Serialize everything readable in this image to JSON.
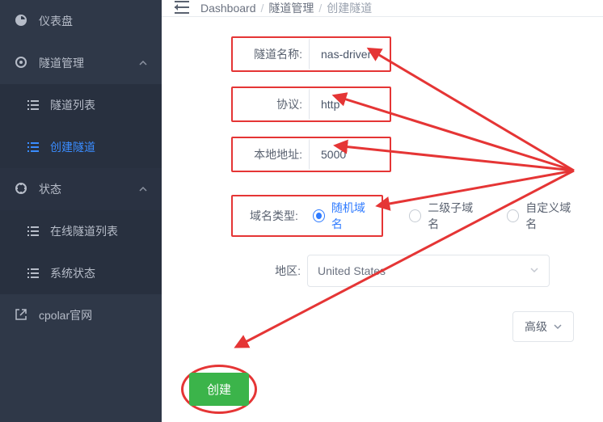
{
  "sidebar": {
    "items": [
      {
        "label": "仪表盘",
        "icon": "dashboard-icon",
        "expandable": false
      },
      {
        "label": "隧道管理",
        "icon": "target-icon",
        "expandable": true,
        "children": [
          {
            "label": "隧道列表",
            "active": false
          },
          {
            "label": "创建隧道",
            "active": true
          }
        ]
      },
      {
        "label": "状态",
        "icon": "status-icon",
        "expandable": true,
        "children": [
          {
            "label": "在线隧道列表",
            "active": false
          },
          {
            "label": "系统状态",
            "active": false
          }
        ]
      },
      {
        "label": "cpolar官网",
        "icon": "external-icon",
        "expandable": false
      }
    ]
  },
  "breadcrumb": {
    "a": "Dashboard",
    "b": "隧道管理",
    "c": "创建隧道"
  },
  "form": {
    "tunnel_name": {
      "label": "隧道名称:",
      "value": "nas-driver"
    },
    "protocol": {
      "label": "协议:",
      "value": "http"
    },
    "local_addr": {
      "label": "本地地址:",
      "value": "5000"
    },
    "domain_type": {
      "label": "域名类型:",
      "options": [
        {
          "key": "random",
          "label": "随机域名",
          "selected": true
        },
        {
          "key": "sub",
          "label": "二级子域名",
          "selected": false
        },
        {
          "key": "custom",
          "label": "自定义域名",
          "selected": false
        }
      ]
    },
    "region": {
      "label": "地区:",
      "value": "United States"
    }
  },
  "buttons": {
    "advanced": "高级",
    "create": "创建"
  },
  "colors": {
    "sidebar_bg": "#2f3848",
    "accent": "#3a8cff",
    "highlight_border": "#e53535",
    "create_bg": "#3bb44a"
  }
}
